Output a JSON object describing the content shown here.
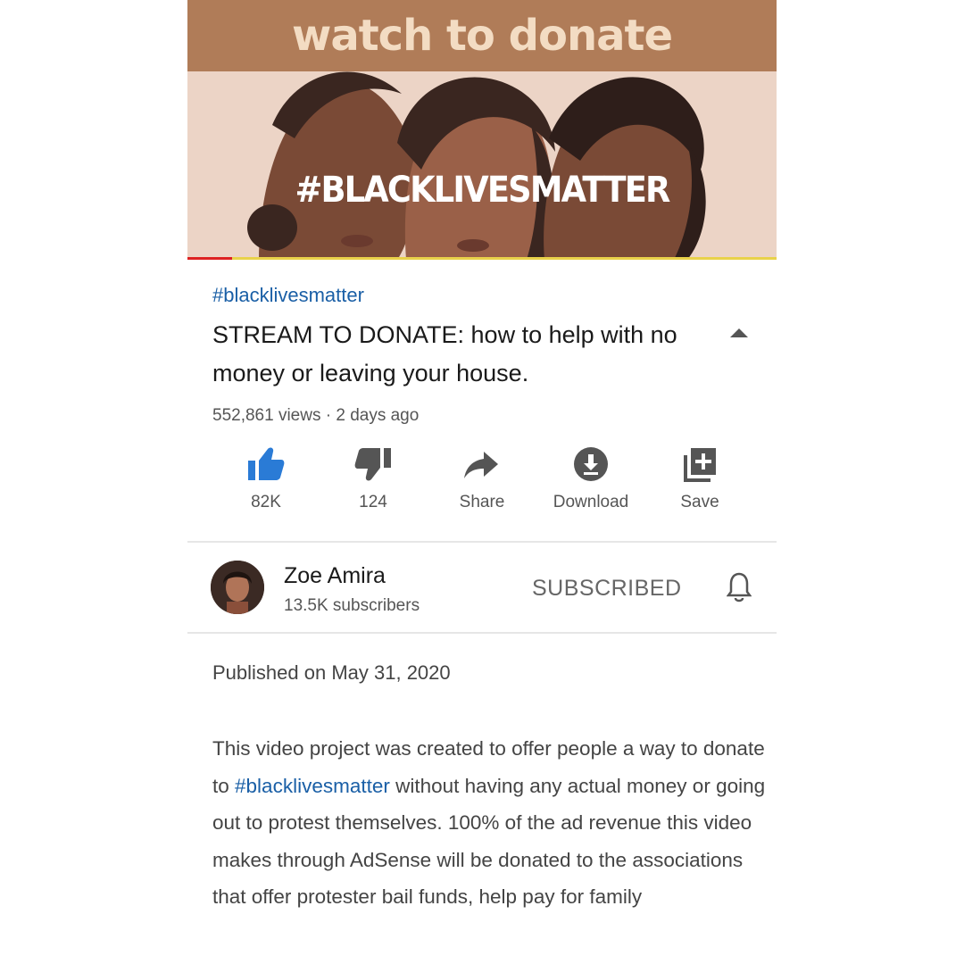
{
  "thumbnail": {
    "banner_text": "watch to donate",
    "overlay_text": "#BLACKLIVESMATTER",
    "colors": {
      "banner": "#b07c58",
      "background": "#ecd4c6",
      "progress_played": "#dd2222",
      "progress_track": "#e9d24a"
    }
  },
  "video": {
    "hashtag": "#blacklivesmatter",
    "title": "STREAM TO DONATE: how to help with no money or leaving your house.",
    "meta": "552,861 views · 2 days ago"
  },
  "actions": {
    "like": {
      "label": "82K",
      "icon": "thumbs-up-icon",
      "active": true
    },
    "dislike": {
      "label": "124",
      "icon": "thumbs-down-icon"
    },
    "share": {
      "label": "Share",
      "icon": "share-arrow-icon"
    },
    "download": {
      "label": "Download",
      "icon": "download-icon"
    },
    "save": {
      "label": "Save",
      "icon": "add-to-playlist-icon"
    }
  },
  "channel": {
    "name": "Zoe Amira",
    "subscribers": "13.5K subscribers",
    "subscribe_label": "SUBSCRIBED",
    "bell_icon": "bell-icon"
  },
  "description": {
    "published": "Published on May 31, 2020",
    "text_before_link": "This video project was created to offer people a way to donate to ",
    "link": "#blacklivesmatter",
    "text_after_link": " without having any actual money or going out to protest themselves. 100% of the ad revenue this video makes through AdSense will be donated to the associations that offer protester bail funds, help pay for family"
  },
  "colors": {
    "link": "#1a5fa6",
    "like_active": "#2a7bd6"
  }
}
